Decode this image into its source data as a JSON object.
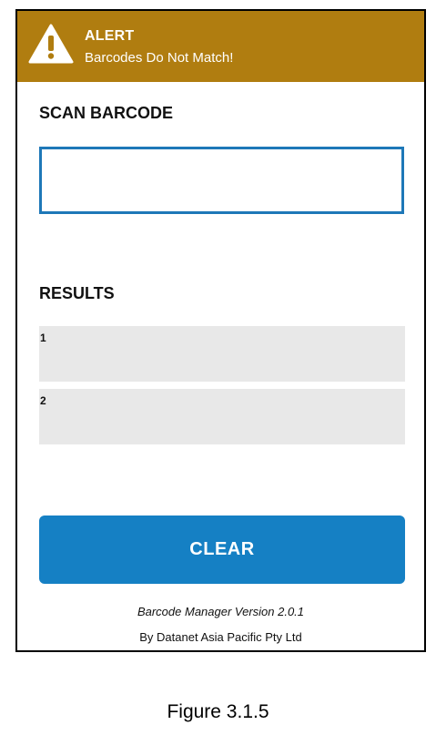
{
  "alert": {
    "title": "ALERT",
    "message": "Barcodes Do Not Match!",
    "icon": "warning-icon",
    "background_color": "#b07d10"
  },
  "scan": {
    "heading": "SCAN BARCODE",
    "value": "",
    "placeholder": "",
    "border_color": "#1e78b8"
  },
  "results": {
    "heading": "RESULTS",
    "items": [
      {
        "index": "1",
        "value": ""
      },
      {
        "index": "2",
        "value": ""
      }
    ]
  },
  "clear_button": {
    "label": "CLEAR",
    "color": "#1580c4"
  },
  "footer": {
    "version": "Barcode Manager Version 2.0.1",
    "company": "By Datanet Asia Pacific Pty Ltd"
  },
  "caption": "Figure 3.1.5"
}
